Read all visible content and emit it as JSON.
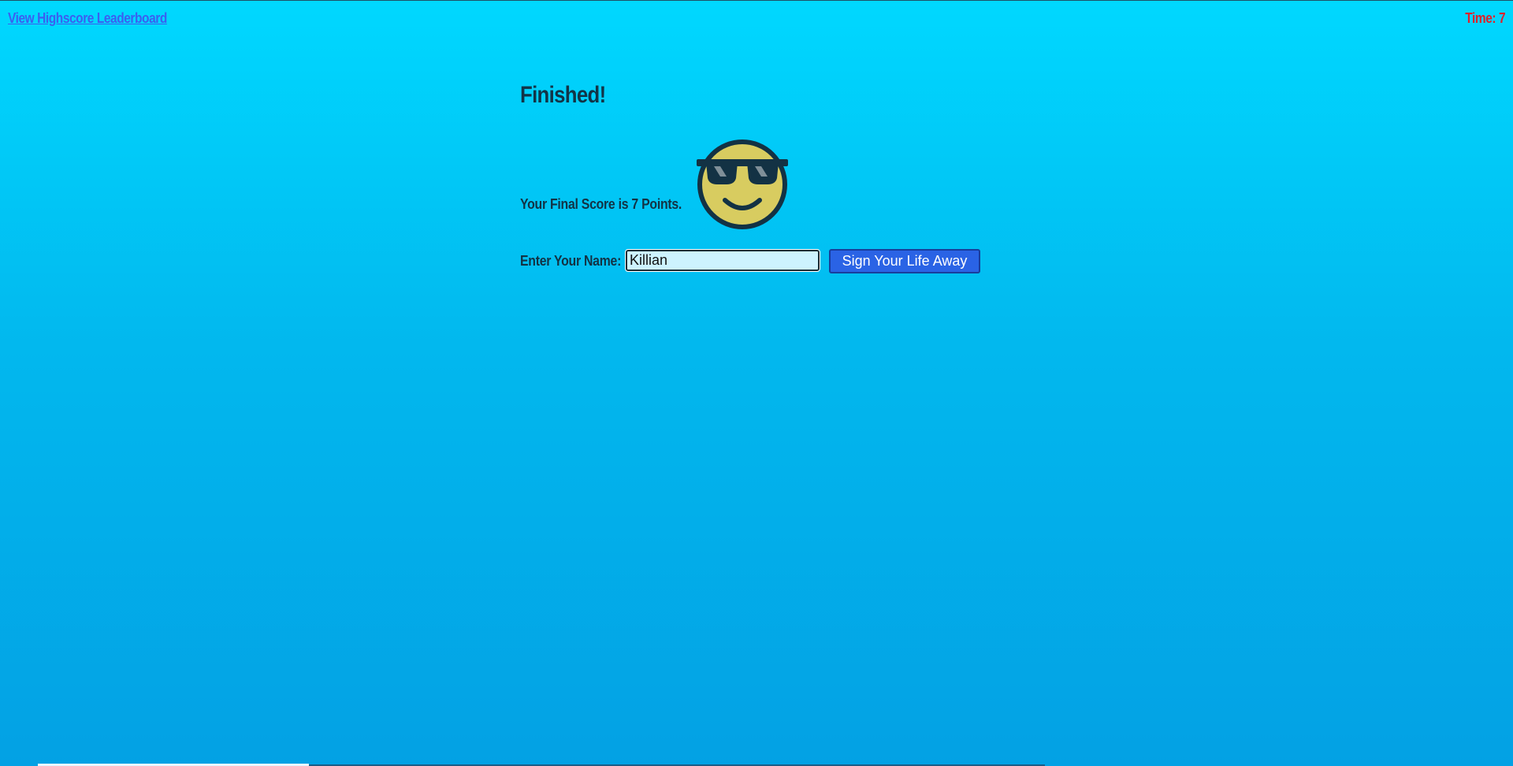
{
  "header": {
    "leaderboard_link": "View Highscore Leaderboard",
    "timer": "Time: 7"
  },
  "main": {
    "title": "Finished!",
    "score_text": "Your Final Score is 7 Points.",
    "emoji_icon": "smiling-face-with-sunglasses-icon",
    "name_label": "Enter Your Name:",
    "name_value": "Killian",
    "submit_label": "Sign Your Life Away"
  },
  "colors": {
    "background_top": "#00d8ff",
    "background_bottom": "#03a1e4",
    "link": "#3b5ff0",
    "timer": "#e0202a",
    "button": "#2a63e5",
    "emoji_face": "#d8cc60",
    "emoji_outline": "#133244"
  }
}
